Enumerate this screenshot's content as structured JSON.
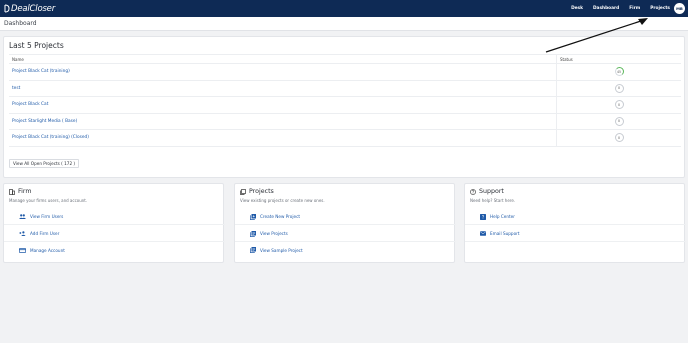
{
  "brand": {
    "name": "DealCloser",
    "nav_bg": "#0e2a55",
    "link_color": "#1f5aa8"
  },
  "nav": {
    "links": [
      "Desk",
      "Dashboard",
      "Firm",
      "Projects"
    ],
    "avatar_initials": "MB"
  },
  "breadcrumb": "Dashboard",
  "projects_card": {
    "title": "Last 5 Projects",
    "columns": [
      "Name",
      "Status"
    ],
    "rows": [
      {
        "name": "Project Black Cat (training)",
        "status": "45",
        "status_kind": "progress"
      },
      {
        "name": "test",
        "status": "0",
        "status_kind": "plain"
      },
      {
        "name": "Project Black Cat",
        "status": "0",
        "status_kind": "plain"
      },
      {
        "name": "Project Starlight Media ( Base)",
        "status": "0",
        "status_kind": "plain"
      },
      {
        "name": "Project Black Cat (training) (Closed)",
        "status": "0",
        "status_kind": "plain"
      }
    ],
    "view_all_label": "View All Open Projects ( 172 )"
  },
  "firm_card": {
    "title": "Firm",
    "subtitle": "Manage your firms users, and account.",
    "items": [
      "View Firm Users",
      "Add Firm User",
      "Manage Account"
    ]
  },
  "projects_mini_card": {
    "title": "Projects",
    "subtitle": "View existing projects or create new ones.",
    "items": [
      "Create New Project",
      "View Projects",
      "View Sample Project"
    ]
  },
  "support_card": {
    "title": "Support",
    "subtitle": "Need help? Start here.",
    "items": [
      "Help Center",
      "Email Support"
    ]
  }
}
